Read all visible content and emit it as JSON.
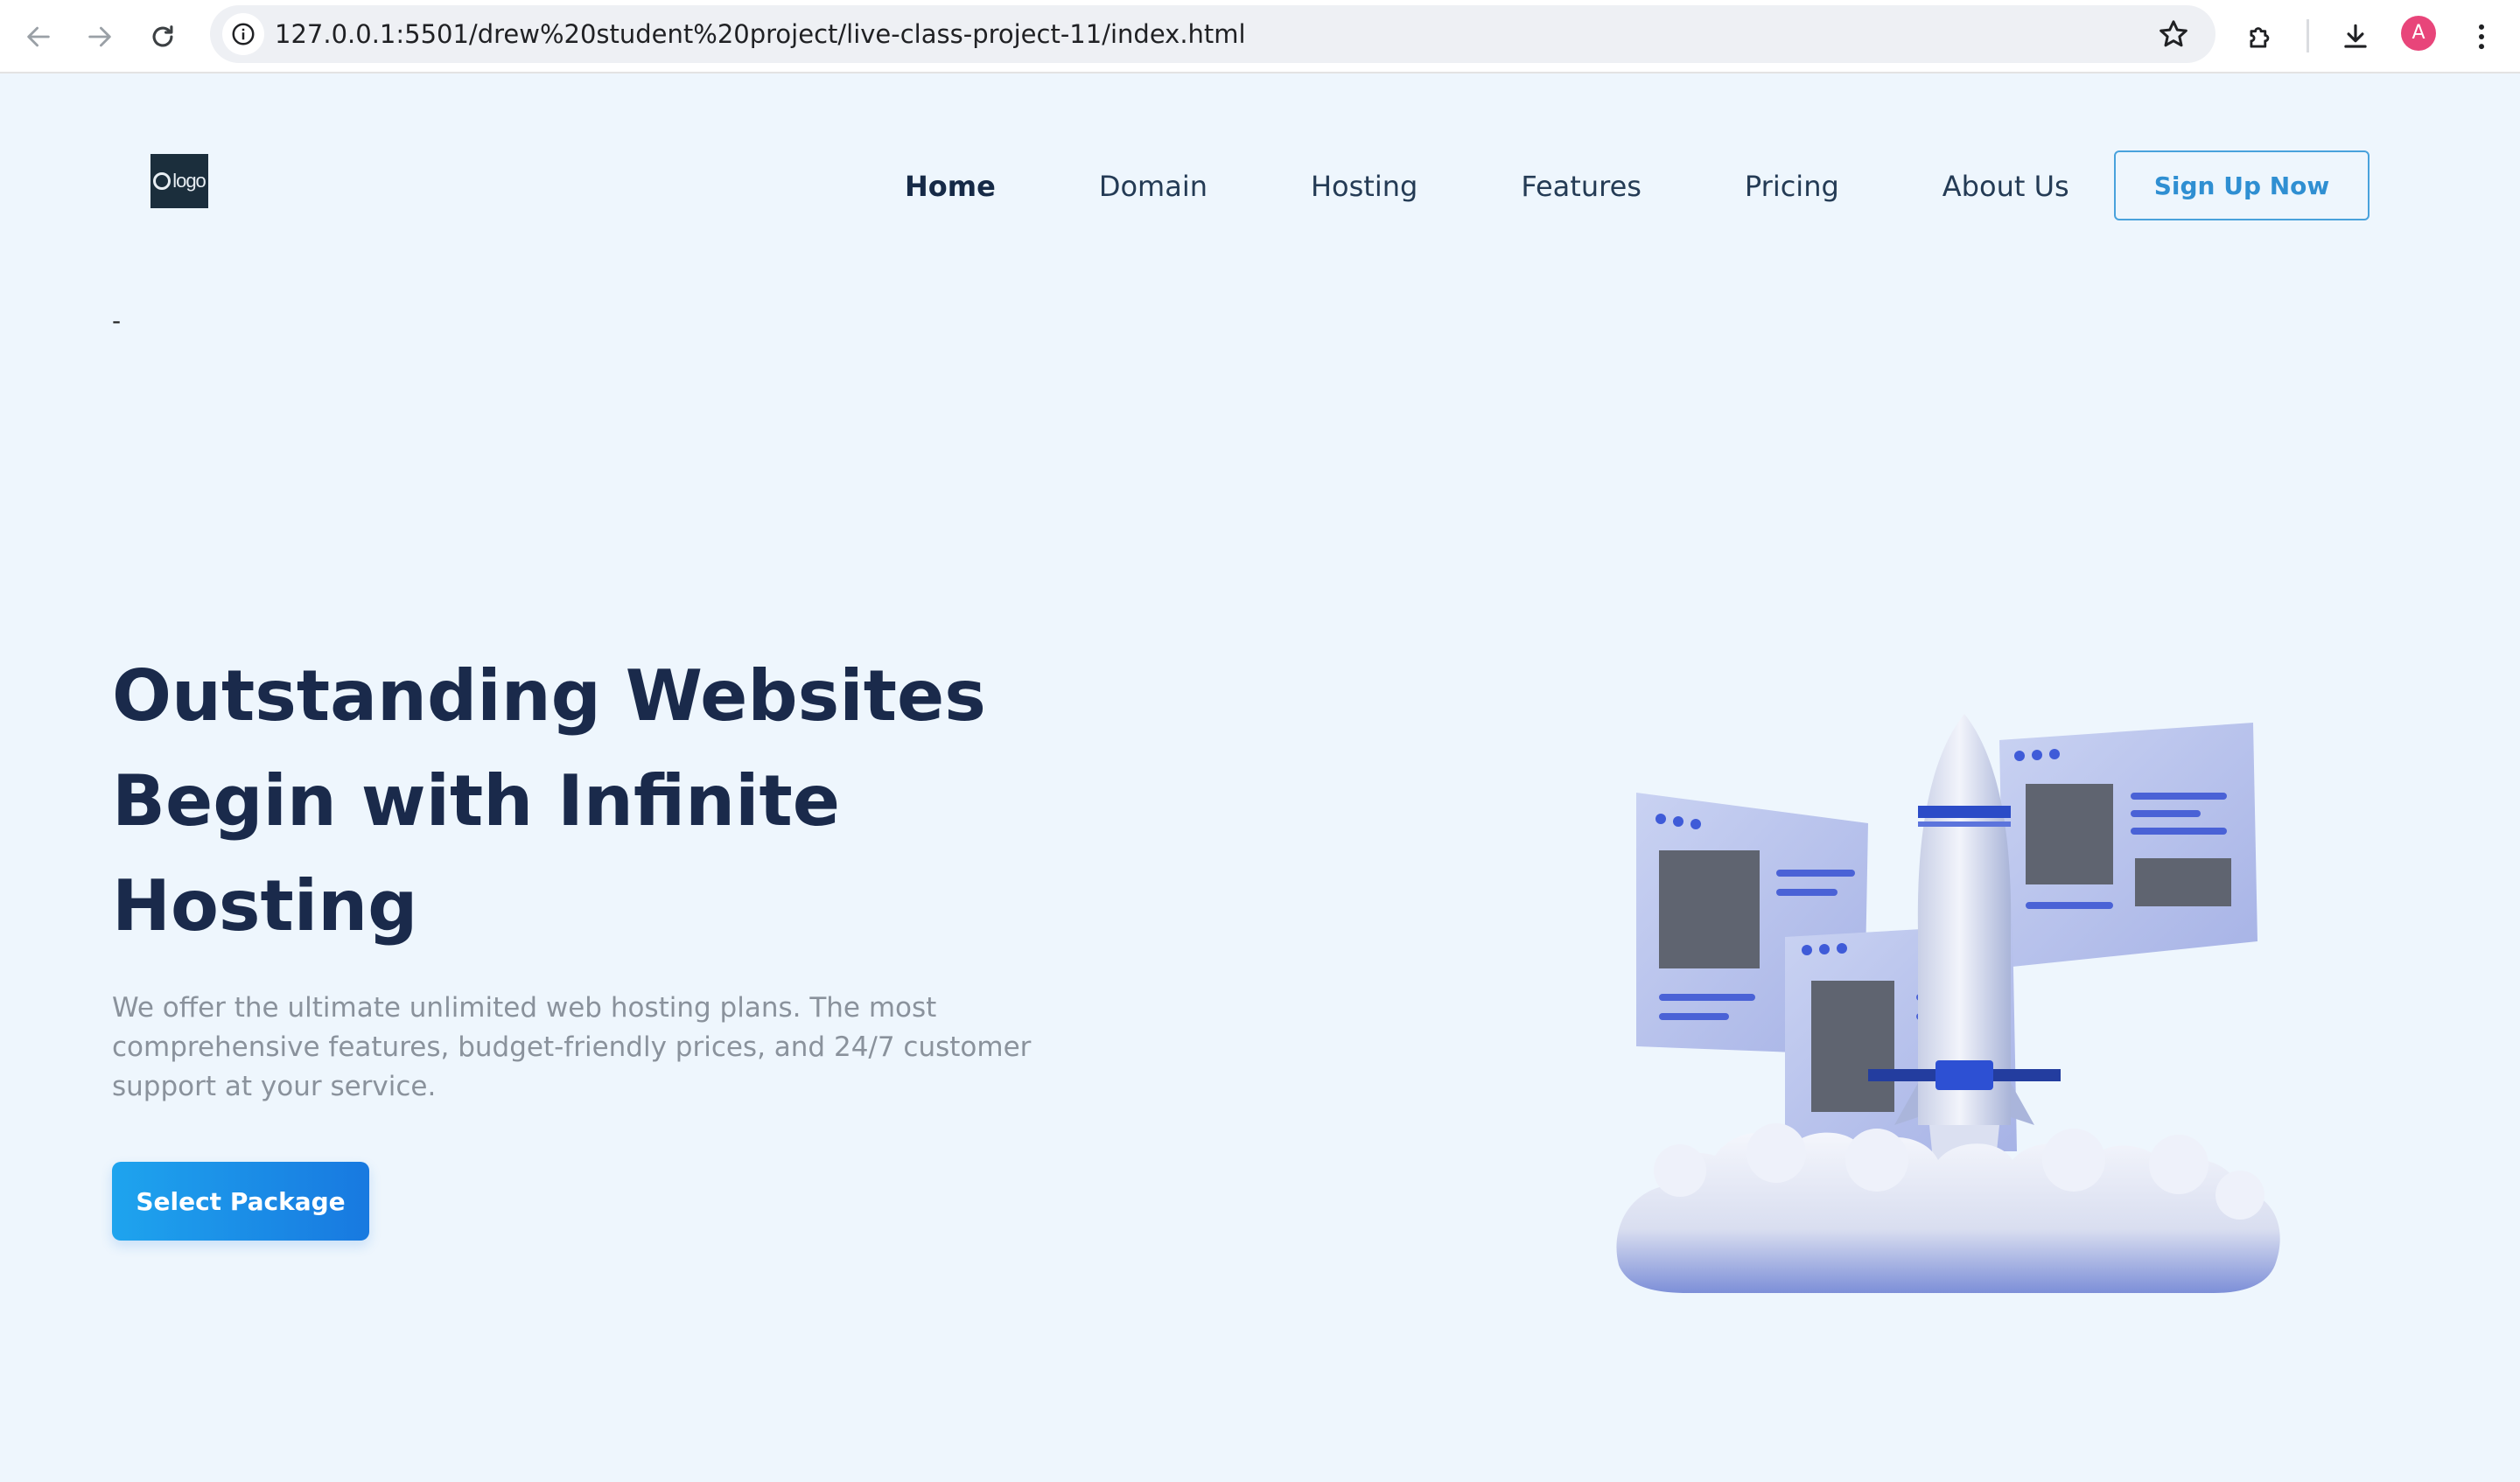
{
  "browser": {
    "url": "127.0.0.1:5501/drew%20student%20project/live-class-project-11/index.html",
    "profile_initial": "A"
  },
  "header": {
    "logo_text": "logo",
    "nav": [
      {
        "label": "Home",
        "active": true
      },
      {
        "label": "Domain",
        "active": false
      },
      {
        "label": "Hosting",
        "active": false
      },
      {
        "label": "Features",
        "active": false
      },
      {
        "label": "Pricing",
        "active": false
      },
      {
        "label": "About Us",
        "active": false
      }
    ],
    "signup_label": "Sign Up Now"
  },
  "stray_text": "-",
  "hero": {
    "title": "Outstanding Websites Begin with Infinite Hosting",
    "subtitle": "We offer the ultimate unlimited web hosting plans. The most comprehensive features, budget-friendly prices, and 24/7 customer support at your service.",
    "cta_label": "Select Package",
    "illustration": "rocket-launch-with-browser-windows-icon"
  },
  "colors": {
    "page_bg": "#eef6fd",
    "heading": "#1a2a4b",
    "accent": "#1e90e8",
    "signup_border": "#49a2dc"
  }
}
